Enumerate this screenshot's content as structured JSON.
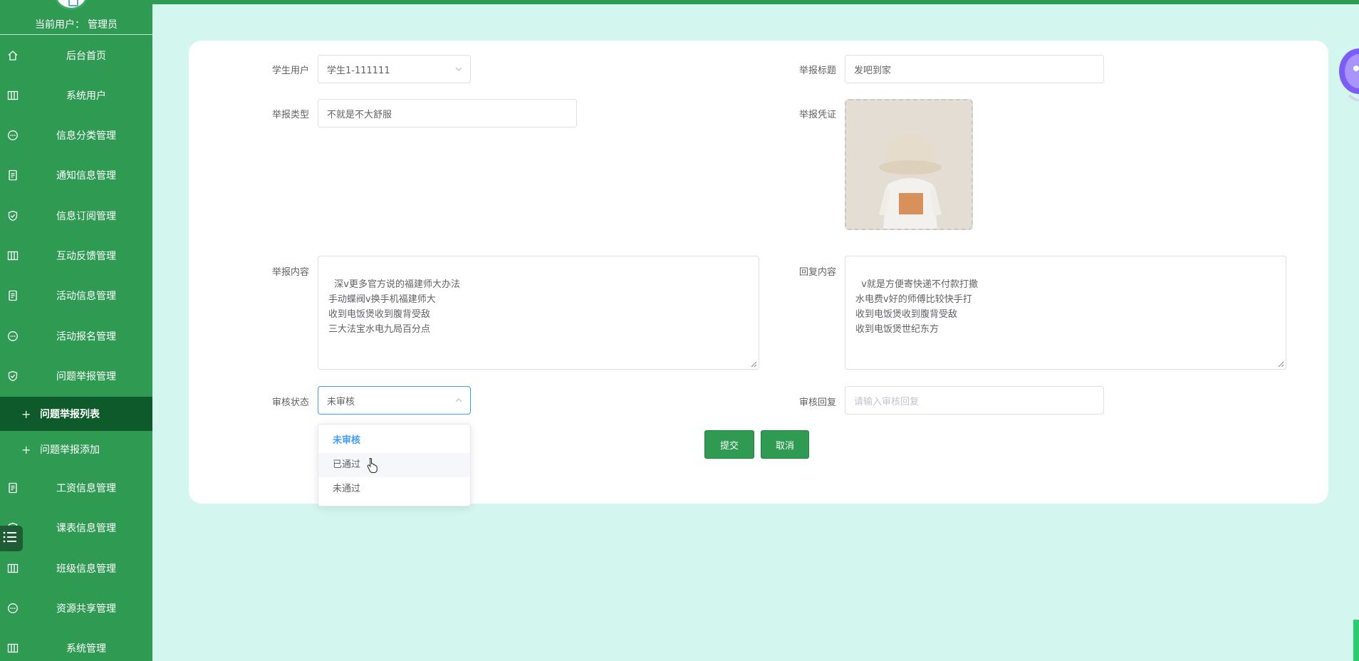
{
  "sidebar": {
    "current_user_label": "当前用户：",
    "current_user_name": "管理员",
    "items": [
      {
        "label": "后台首页",
        "icon": "home-icon"
      },
      {
        "label": "系统用户",
        "icon": "columns-icon"
      },
      {
        "label": "信息分类管理",
        "icon": "chat-icon"
      },
      {
        "label": "通知信息管理",
        "icon": "document-icon"
      },
      {
        "label": "信息订阅管理",
        "icon": "shield-check-icon"
      },
      {
        "label": "互动反馈管理",
        "icon": "columns-icon"
      },
      {
        "label": "活动信息管理",
        "icon": "document-icon"
      },
      {
        "label": "活动报名管理",
        "icon": "chat-icon"
      },
      {
        "label": "问题举报管理",
        "icon": "shield-check-icon"
      },
      {
        "label": "工资信息管理",
        "icon": "document-icon"
      },
      {
        "label": "课表信息管理",
        "icon": "shield-check-icon"
      },
      {
        "label": "班级信息管理",
        "icon": "columns-icon"
      },
      {
        "label": "资源共享管理",
        "icon": "chat-icon"
      },
      {
        "label": "系统管理",
        "icon": "columns-icon"
      }
    ],
    "submenu": [
      {
        "label": "问题举报列表",
        "active": true
      },
      {
        "label": "问题举报添加",
        "active": false
      }
    ]
  },
  "form": {
    "student_user": {
      "label": "学生用户",
      "value": "学生1-111111"
    },
    "report_title": {
      "label": "举报标题",
      "value": "发吧到家"
    },
    "report_type": {
      "label": "举报类型",
      "value": "不就是不大舒服"
    },
    "evidence": {
      "label": "举报凭证"
    },
    "report_content": {
      "label": "举报内容",
      "value": "深v更多官方说的福建师大办法\n手动蝶阀v换手机福建师大\n收到电饭煲收到腹背受敌\n三大法宝水电九局百分点"
    },
    "reply_content": {
      "label": "回复内容",
      "value": "v就是方便寄快递不付款打撒\n水电费v好的师傅比较快手打\n收到电饭煲收到腹背受敌\n收到电饭煲世纪东方"
    },
    "audit_status": {
      "label": "审核状态",
      "value": "未审核",
      "options": [
        "未审核",
        "已通过",
        "未通过"
      ]
    },
    "audit_reply": {
      "label": "审核回复",
      "placeholder": "请输入审核回复"
    }
  },
  "buttons": {
    "submit": "提交",
    "cancel": "取消"
  },
  "colors": {
    "primary": "#2e9a52",
    "selected_option": "#409eff",
    "background": "#d3f6ef"
  }
}
